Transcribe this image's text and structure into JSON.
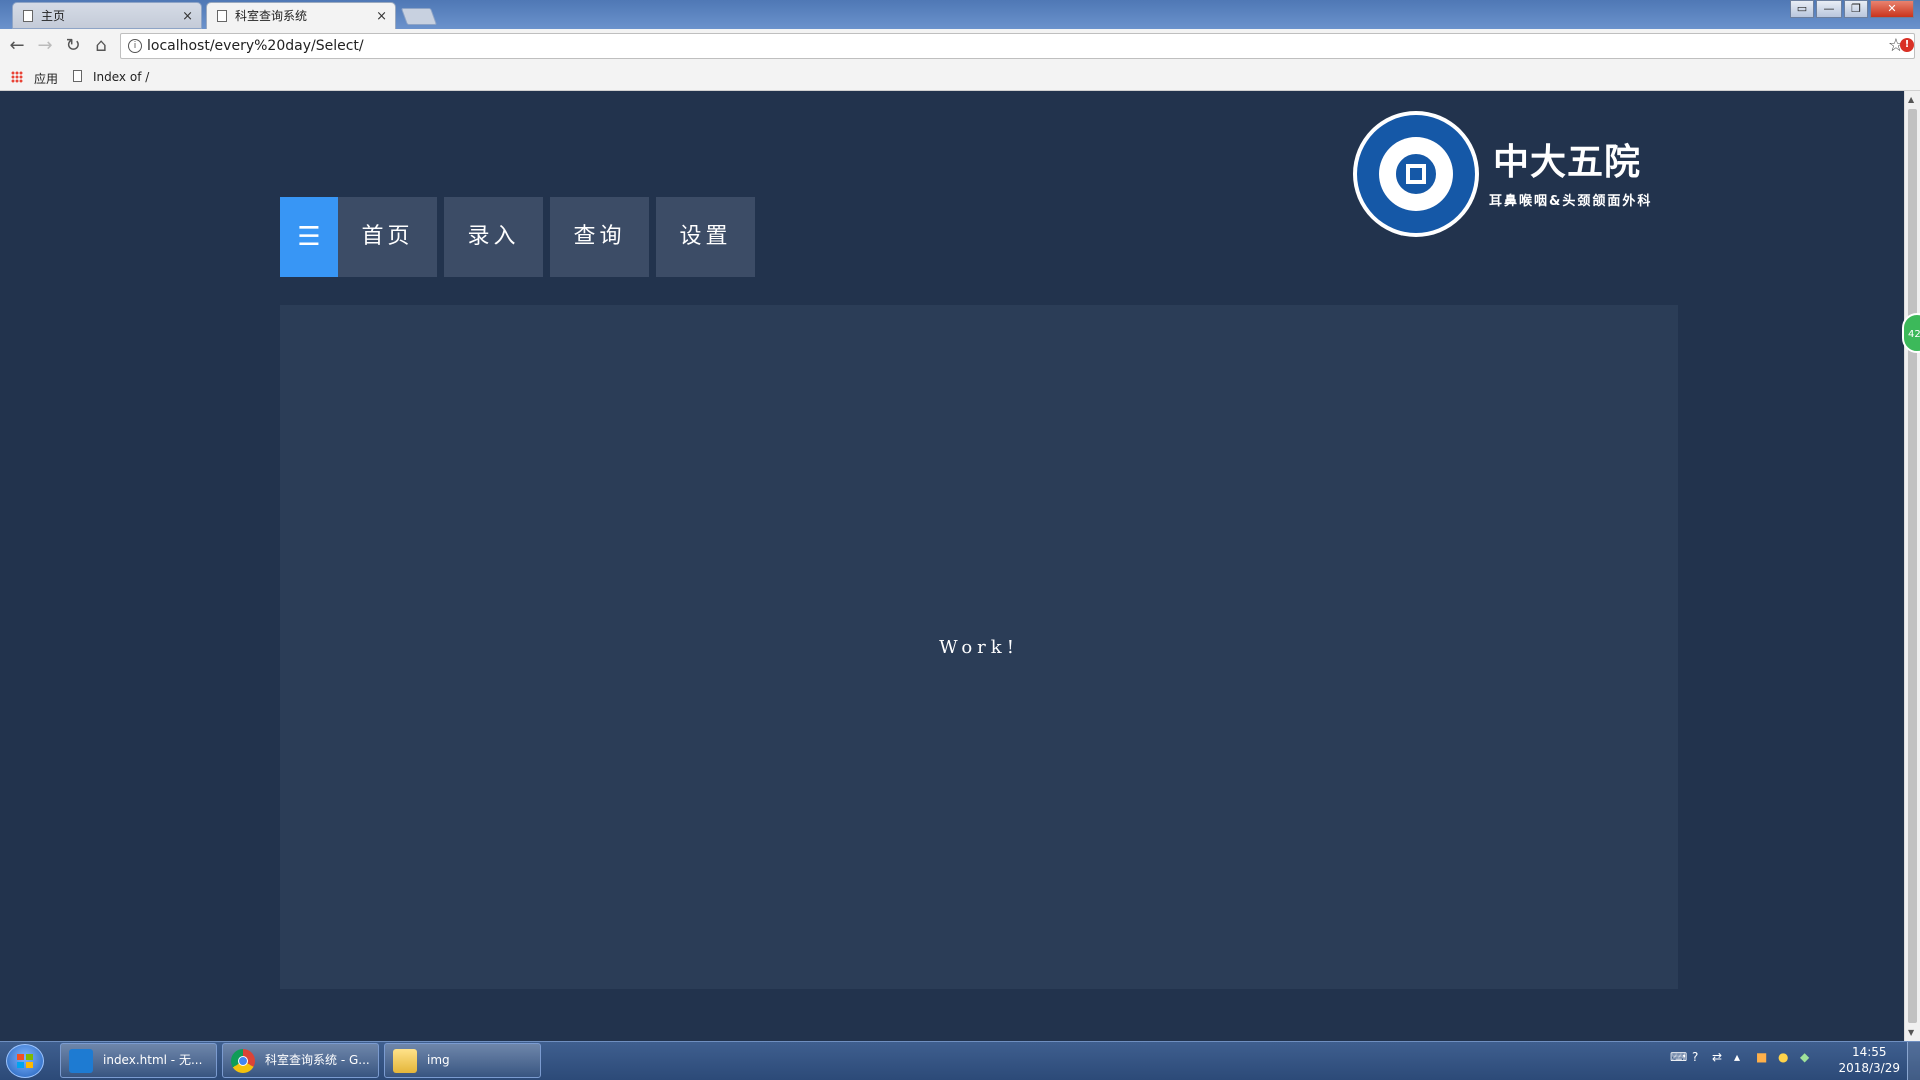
{
  "browser": {
    "tabs": [
      {
        "title": "主页",
        "active": false
      },
      {
        "title": "科室查询系统",
        "active": true
      }
    ],
    "tab_close_glyph": "×",
    "address": "localhost/every%20day/Select/",
    "bookmarks": [
      {
        "label": "应用",
        "icon": "apps-icon"
      },
      {
        "label": "Index of /",
        "icon": "page-icon"
      }
    ],
    "window_controls": [
      "▭",
      "—",
      "❐",
      "✕"
    ]
  },
  "page": {
    "nav": {
      "menu_glyph": "☰",
      "items": [
        "首页",
        "录入",
        "查询",
        "设置"
      ]
    },
    "logo": {
      "title": "中大五院",
      "subtitle": "耳鼻喉咽&头颈颌面外科"
    },
    "content_text": "Work!",
    "floating_badge": "42"
  },
  "taskbar": {
    "items": [
      {
        "label": "index.html - 无...",
        "icon": "vscode-icon"
      },
      {
        "label": "科室查询系统 - G...",
        "icon": "chrome-icon"
      },
      {
        "label": "img",
        "icon": "folder-icon"
      }
    ],
    "time": "14:55",
    "date": "2018/3/29"
  },
  "colors": {
    "page_bg": "#22334d",
    "panel_bg": "#2b3d57",
    "nav_item_bg": "#3c4c66",
    "accent": "#3896f5",
    "logo_blue": "#1558a7"
  }
}
